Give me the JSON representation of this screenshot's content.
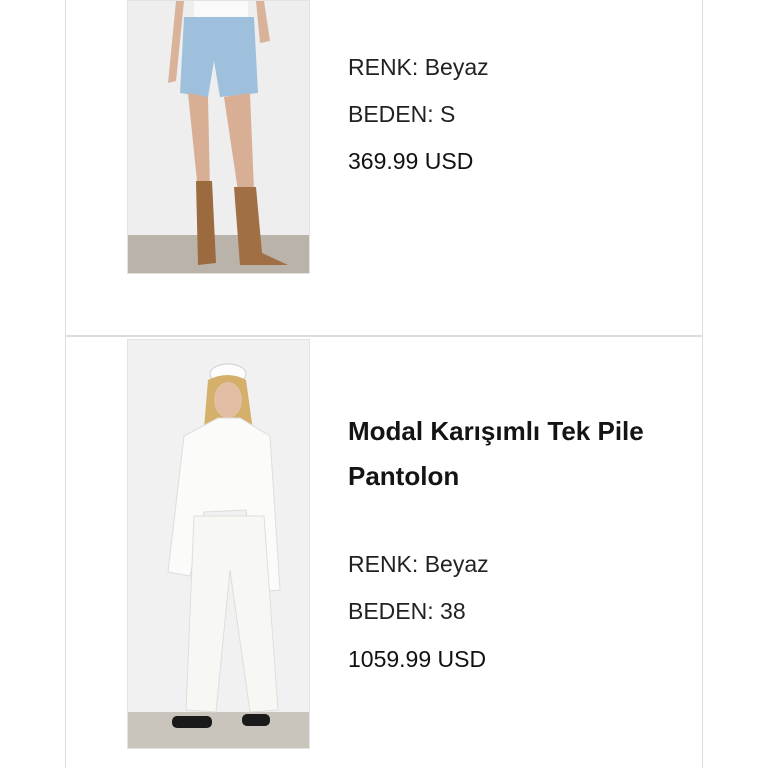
{
  "products": [
    {
      "color_label": "RENK:",
      "color_value": "Beyaz",
      "size_label": "BEDEN:",
      "size_value": "S",
      "price": "369.99 USD"
    },
    {
      "title": "Modal Karışımlı Tek Pile Pantolon",
      "color_label": "RENK:",
      "color_value": "Beyaz",
      "size_label": "BEDEN:",
      "size_value": "38",
      "price": "1059.99 USD"
    }
  ],
  "colors": {
    "divider": "#dcdcdc",
    "text": "#222222"
  }
}
